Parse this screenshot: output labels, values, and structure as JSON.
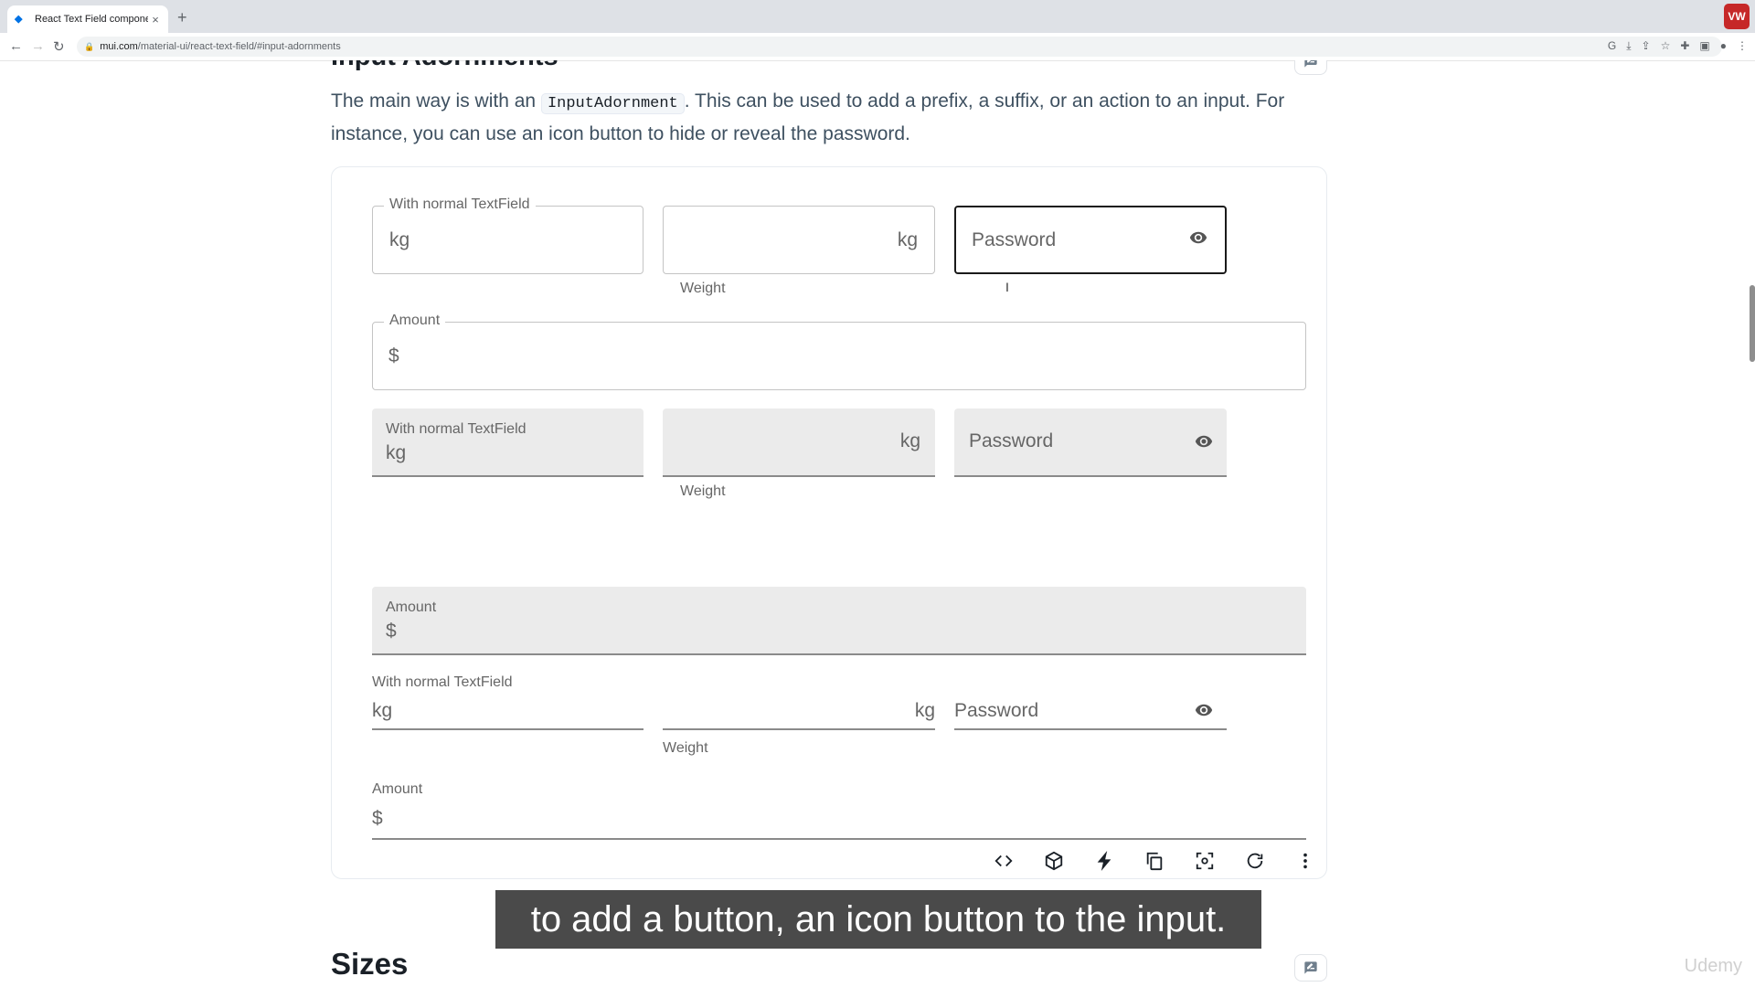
{
  "browser": {
    "tab_title": "React Text Field component - M",
    "tab_close": "×",
    "new_tab": "+",
    "profile_badge": "VW",
    "url_host": "mui.com",
    "url_path": "/material-ui/react-text-field/#input-adornments"
  },
  "section": {
    "heading": "Input Adornments",
    "intro_before": "The main way is with an ",
    "intro_code": "InputAdornment",
    "intro_after": ". This can be used to add a prefix, a suffix, or an action to an input. For instance, you can use an icon button to hide or reveal the password."
  },
  "outlined": {
    "normal_label": "With normal TextField",
    "normal_adornment": "kg",
    "weight_adornment": "kg",
    "weight_helper": "Weight",
    "password_placeholder": "Password",
    "amount_label": "Amount",
    "amount_adornment": "$"
  },
  "filled": {
    "normal_label": "With normal TextField",
    "normal_adornment": "kg",
    "weight_adornment": "kg",
    "weight_helper": "Weight",
    "password_placeholder": "Password",
    "amount_label": "Amount",
    "amount_adornment": "$"
  },
  "standard": {
    "normal_label": "With normal TextField",
    "normal_adornment": "kg",
    "weight_adornment": "kg",
    "weight_helper": "Weight",
    "password_placeholder": "Password",
    "amount_label": "Amount",
    "amount_adornment": "$"
  },
  "toolbar_icons": [
    "code-icon",
    "codesandbox-icon",
    "stackblitz-icon",
    "copy-icon",
    "screenshot-icon",
    "reset-icon",
    "more-icon"
  ],
  "next_heading": "Sizes",
  "caption": "to add a button, an icon button to the input.",
  "watermark": "Udemy"
}
